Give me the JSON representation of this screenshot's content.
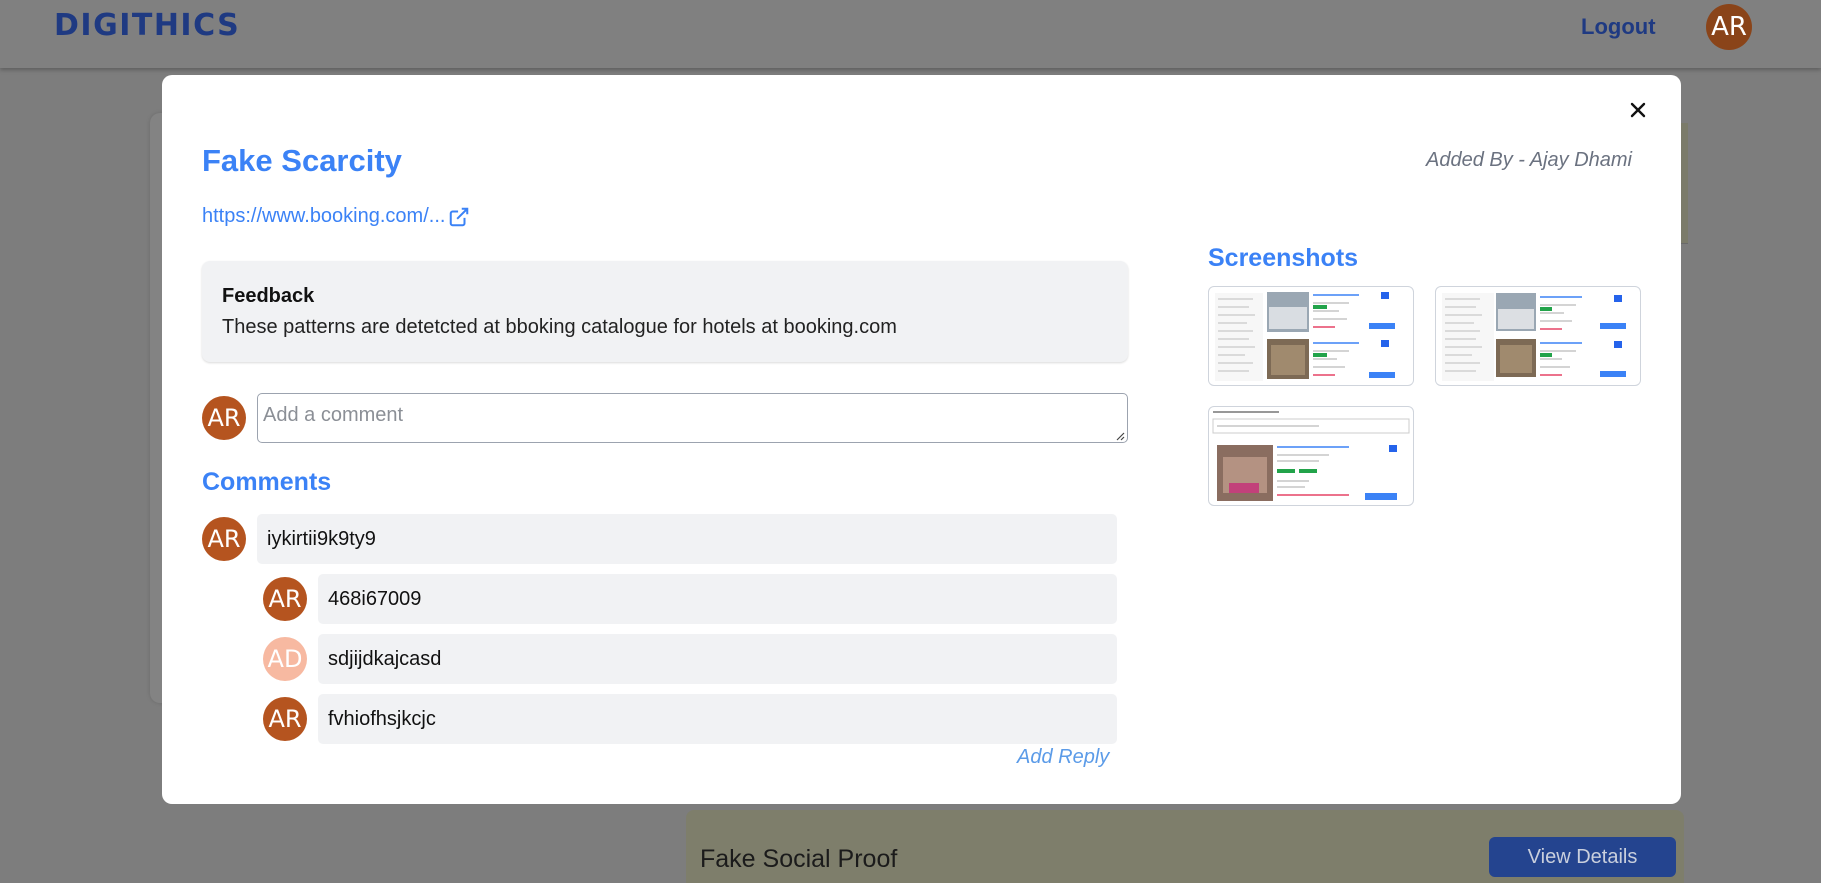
{
  "app": {
    "brand": "DIGITHICS",
    "logout_label": "Logout",
    "user_initials": "AR"
  },
  "background": {
    "card_title": "Fake Social Proof",
    "view_details_label": "View Details"
  },
  "modal": {
    "title": "Fake Scarcity",
    "added_by": "Added By - Ajay Dhami",
    "link_text": "https://www.booking.com/...",
    "feedback_title": "Feedback",
    "feedback_text": "These patterns are detetcted at bboking catalogue for hotels at booking.com",
    "comment_placeholder": "Add a comment",
    "current_user_initials": "AR",
    "comments_title": "Comments",
    "comments": [
      {
        "initials": "AR",
        "text": "iykirtii9k9ty9",
        "avatar_color": "#b5541f"
      },
      {
        "initials": "AR",
        "text": "468i67009",
        "avatar_color": "#b5541f"
      },
      {
        "initials": "AD",
        "text": "sdjijdkajcasd",
        "avatar_color": "#f7b9a1"
      },
      {
        "initials": "AR",
        "text": "fvhiofhsjkcjc",
        "avatar_color": "#b5541f"
      }
    ],
    "add_reply_label": "Add Reply",
    "screenshots_title": "Screenshots",
    "screenshot_count": 3
  },
  "colors": {
    "accent": "#3b82f6",
    "brand": "#1f3a82",
    "avatar_ar": "#b5541f",
    "avatar_ad": "#f7b9a1",
    "panel_bg": "#f1f2f4"
  }
}
